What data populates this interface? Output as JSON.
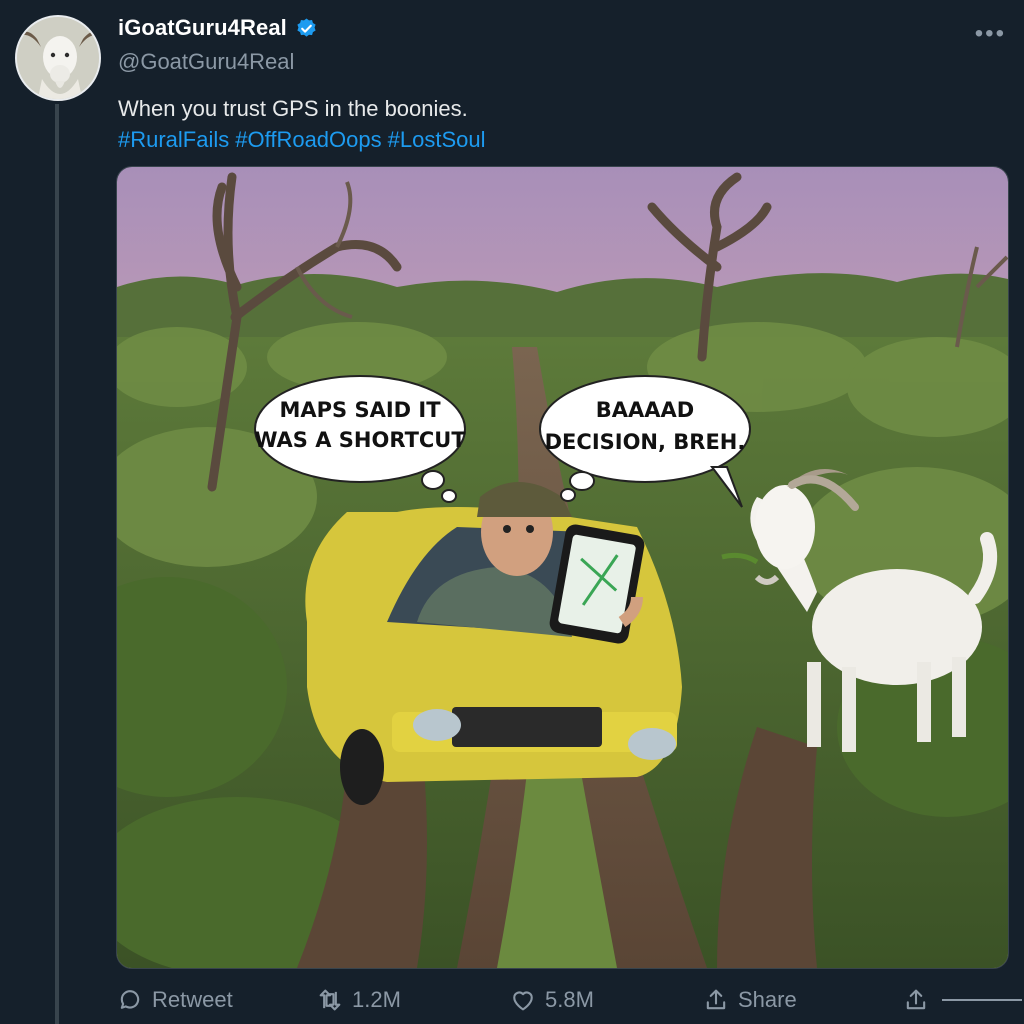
{
  "post": {
    "display_name": "iGoatGuru4Real",
    "handle": "@GoatGuru4Real",
    "verified": true,
    "text": "When you trust GPS in the boonies.",
    "hashtags": [
      "#RuralFails",
      "#OffRoadOops",
      "#LostSoul"
    ]
  },
  "media": {
    "bubble_left_line1": "MAPS SAID IT",
    "bubble_left_line2": "WAS A SHORTCUT",
    "bubble_right_line1": "BAAAAD",
    "bubble_right_line2": "DECISION, BREH."
  },
  "actions": {
    "reply_label": "Retweet",
    "retweet_count": "1.2M",
    "like_count": "5.8M",
    "share_label": "Share"
  },
  "colors": {
    "background": "#15202b",
    "link": "#1d9bf0",
    "verified_badge": "#1d9bf0",
    "muted": "#8b98a5"
  },
  "icons": [
    "more-icon",
    "verified-badge-icon",
    "reply-icon",
    "retweet-icon",
    "heart-icon",
    "share-icon",
    "upload-icon"
  ]
}
